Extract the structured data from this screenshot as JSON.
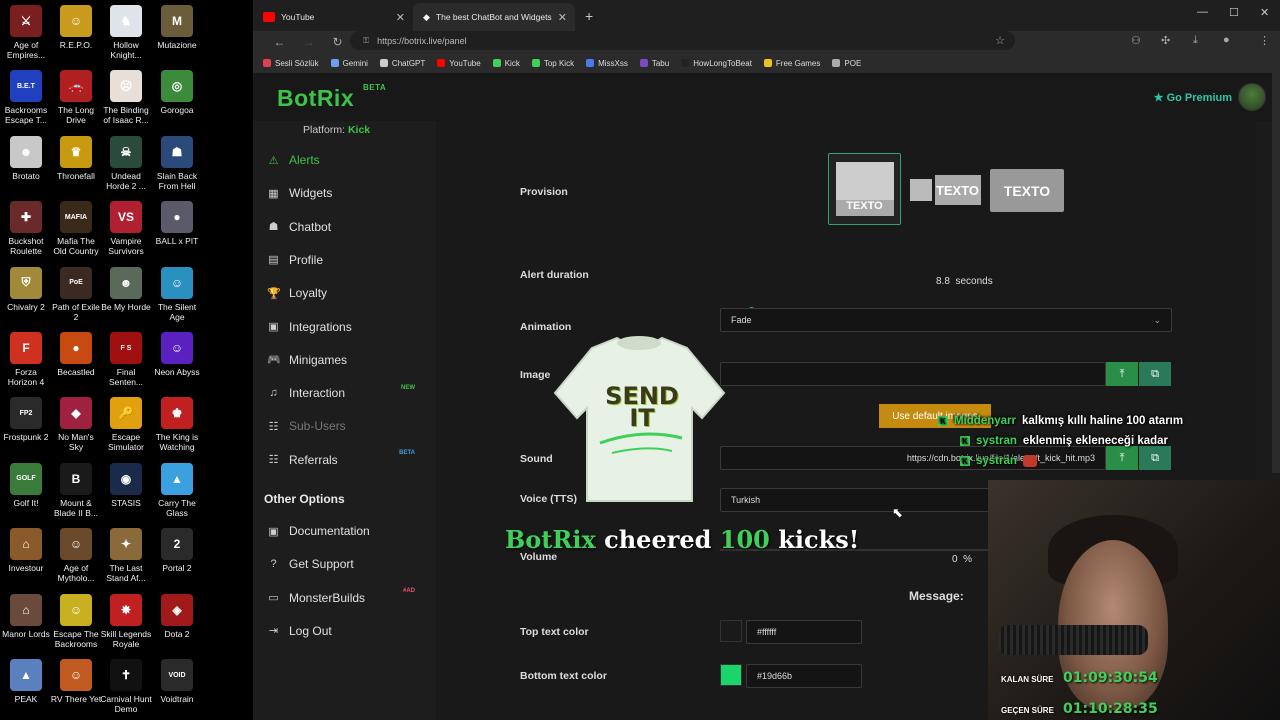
{
  "desktop": {
    "icons": [
      {
        "label": "Age of Empires...",
        "color": "#7a1f1f",
        "glyph": "⚔"
      },
      {
        "label": "R.E.P.O.",
        "color": "#c89b1e",
        "glyph": "☺"
      },
      {
        "label": "Hollow Knight...",
        "color": "#dfe3ea",
        "glyph": "♞"
      },
      {
        "label": "Mutazione",
        "color": "#6b5c3a",
        "glyph": "M"
      },
      {
        "label": "Backrooms Escape T...",
        "color": "#2040c0",
        "glyph": "B.E.T"
      },
      {
        "label": "The Long Drive",
        "color": "#b02020",
        "glyph": "🚗"
      },
      {
        "label": "The Binding of Isaac R...",
        "color": "#e8e0d8",
        "glyph": "☹"
      },
      {
        "label": "Gorogoa",
        "color": "#3c8a3c",
        "glyph": "◎"
      },
      {
        "label": "Brotato",
        "color": "#c8c8c8",
        "glyph": "☻"
      },
      {
        "label": "Thronefall",
        "color": "#c89a10",
        "glyph": "♛"
      },
      {
        "label": "Undead Horde 2 ...",
        "color": "#2a4a3a",
        "glyph": "☠"
      },
      {
        "label": "Slain Back From Hell",
        "color": "#2a4a7a",
        "glyph": "☗"
      },
      {
        "label": "Buckshot Roulette",
        "color": "#6a2a2a",
        "glyph": "✚"
      },
      {
        "label": "Mafia The Old Country",
        "color": "#3a2a1a",
        "glyph": "MAFIA"
      },
      {
        "label": "Vampire Survivors",
        "color": "#b02030",
        "glyph": "VS"
      },
      {
        "label": "BALL x PIT",
        "color": "#5a5a6a",
        "glyph": "●"
      },
      {
        "label": "Chivalry 2",
        "color": "#a08a3a",
        "glyph": "⛨"
      },
      {
        "label": "Path of Exile 2",
        "color": "#3a2a22",
        "glyph": "PoE"
      },
      {
        "label": "Be My Horde",
        "color": "#5a6a5a",
        "glyph": "☻"
      },
      {
        "label": "The Silent Age",
        "color": "#2a90c0",
        "glyph": "☺"
      },
      {
        "label": "Forza Horizon 4",
        "color": "#d03020",
        "glyph": "F"
      },
      {
        "label": "Becastled",
        "color": "#c84a10",
        "glyph": "●"
      },
      {
        "label": "Final Senten...",
        "color": "#a01010",
        "glyph": "F S"
      },
      {
        "label": "Neon Abyss",
        "color": "#5a20c0",
        "glyph": "☺"
      },
      {
        "label": "Frostpunk 2",
        "color": "#2a2a2a",
        "glyph": "FP2"
      },
      {
        "label": "No Man's Sky",
        "color": "#a02040",
        "glyph": "◆"
      },
      {
        "label": "Escape Simulator",
        "color": "#e0a010",
        "glyph": "🔑"
      },
      {
        "label": "The King is Watching",
        "color": "#c02020",
        "glyph": "♚"
      },
      {
        "label": "Golf It!",
        "color": "#3a7a3a",
        "glyph": "GOLF"
      },
      {
        "label": "Mount & Blade II B...",
        "color": "#1a1a1a",
        "glyph": "B"
      },
      {
        "label": "STASIS",
        "color": "#1a2a4a",
        "glyph": "◉"
      },
      {
        "label": "Carry The Glass",
        "color": "#3aa0e0",
        "glyph": "▲"
      },
      {
        "label": "Investour",
        "color": "#8a5a2a",
        "glyph": "⌂"
      },
      {
        "label": "Age of Mytholo...",
        "color": "#6a4a2a",
        "glyph": "☺"
      },
      {
        "label": "The Last Stand Af...",
        "color": "#8a6a3a",
        "glyph": "✦"
      },
      {
        "label": "Portal 2",
        "color": "#2a2a2a",
        "glyph": "2"
      },
      {
        "label": "Manor Lords",
        "color": "#6a4a3a",
        "glyph": "⌂"
      },
      {
        "label": "Escape The Backrooms",
        "color": "#c8b020",
        "glyph": "☺"
      },
      {
        "label": "Skill Legends Royale",
        "color": "#c02020",
        "glyph": "✸"
      },
      {
        "label": "Dota 2",
        "color": "#a01a1a",
        "glyph": "◈"
      },
      {
        "label": "PEAK",
        "color": "#5a80c0",
        "glyph": "▲"
      },
      {
        "label": "RV There Yet",
        "color": "#c05a20",
        "glyph": "☺"
      },
      {
        "label": "Carnival Hunt Demo",
        "color": "#111111",
        "glyph": "✝"
      },
      {
        "label": "Voidtrain",
        "color": "#2a2a2a",
        "glyph": "VOID"
      }
    ]
  },
  "browser": {
    "tabs": [
      {
        "label": "YouTube",
        "color": "#ff0000"
      },
      {
        "label": "The best ChatBot and Widgets fo",
        "color": "#ffffff"
      }
    ],
    "url": "https://botrix.live/panel",
    "bookmarks": [
      {
        "label": "Sesli Sözlük",
        "color": "#e04050"
      },
      {
        "label": "Gemini",
        "color": "#6aa0f0"
      },
      {
        "label": "ChatGPT",
        "color": "#cccccc"
      },
      {
        "label": "YouTube",
        "color": "#ff0000"
      },
      {
        "label": "Kick",
        "color": "#3fd05a"
      },
      {
        "label": "Top Kick",
        "color": "#3fd05a"
      },
      {
        "label": "MissXss",
        "color": "#4a7af0"
      },
      {
        "label": "Tabu",
        "color": "#7a4ac0"
      },
      {
        "label": "HowLongToBeat",
        "color": "#222222"
      },
      {
        "label": "Free Games",
        "color": "#f0c020"
      },
      {
        "label": "POE",
        "color": "#aaaaaa"
      }
    ]
  },
  "header": {
    "logo": "BotRix",
    "logo_badge": "BETA",
    "premium": "Go Premium"
  },
  "sidebar": {
    "platform_label": "Platform:",
    "platform_value": "Kick",
    "items": [
      {
        "label": "Alerts",
        "icon": "⚠",
        "icon_name": "alert-icon",
        "state": "active",
        "tag": ""
      },
      {
        "label": "Widgets",
        "icon": "▦",
        "icon_name": "widgets-icon",
        "state": "",
        "tag": ""
      },
      {
        "label": "Chatbot",
        "icon": "☗",
        "icon_name": "robot-icon",
        "state": "",
        "tag": ""
      },
      {
        "label": "Profile",
        "icon": "▤",
        "icon_name": "profile-icon",
        "state": "",
        "tag": ""
      },
      {
        "label": "Loyalty",
        "icon": "🏆",
        "icon_name": "trophy-icon",
        "state": "",
        "tag": ""
      },
      {
        "label": "Integrations",
        "icon": "▣",
        "icon_name": "integrations-icon",
        "state": "",
        "tag": ""
      },
      {
        "label": "Minigames",
        "icon": "🎮",
        "icon_name": "gamepad-icon",
        "state": "",
        "tag": ""
      },
      {
        "label": "Interaction",
        "icon": "♫",
        "icon_name": "music-icon",
        "state": "",
        "tag": "NEW"
      },
      {
        "label": "Sub-Users",
        "icon": "☷",
        "icon_name": "users-icon",
        "state": "disabled",
        "tag": ""
      },
      {
        "label": "Referrals",
        "icon": "☷",
        "icon_name": "referrals-icon",
        "state": "",
        "tag": "BETA"
      }
    ],
    "other_title": "Other Options",
    "other_items": [
      {
        "label": "Documentation",
        "icon": "▣",
        "icon_name": "documentation-icon",
        "tag": ""
      },
      {
        "label": "Get Support",
        "icon": "?",
        "icon_name": "help-icon",
        "tag": ""
      },
      {
        "label": "MonsterBuilds",
        "icon": "▭",
        "icon_name": "laptop-icon",
        "tag": "#AD"
      },
      {
        "label": "Log Out",
        "icon": "⇥",
        "icon_name": "logout-icon",
        "tag": ""
      }
    ]
  },
  "form": {
    "provision_label": "Provision",
    "provision_options": [
      "TEXTO",
      "TEXTO",
      "TEXTO"
    ],
    "alert_duration_label": "Alert duration",
    "alert_duration_value": "8.8",
    "alert_duration_unit": "seconds",
    "alert_duration_fraction": 0.068,
    "animation_label": "Animation",
    "animation_value": "Fade",
    "image_label": "Image",
    "image_value": "",
    "use_default": "Use default images",
    "sound_label": "Sound",
    "sound_value": "https://cdn.botrix.live/file/1/alerts/t_kick_hit.mp3",
    "voice_label": "Voice (TTS)",
    "voice_value": "Turkish",
    "volume_label": "Volume",
    "volume_value": "0",
    "volume_unit": "%",
    "message_label": "Message:",
    "top_text_label": "Top text color",
    "top_text_value": "#ffffff",
    "top_text_color": "#1a1a1a",
    "bottom_text_label": "Bottom text color",
    "bottom_text_value": "#19d66b",
    "bottom_text_color": "#19d66b"
  },
  "overlay": {
    "shirt_line1": "SEND",
    "shirt_line2": "IT",
    "cheer_user": "BotRix",
    "cheer_mid": "cheered",
    "cheer_amount": "100",
    "cheer_end": "kicks!",
    "chat": [
      {
        "user": "Middenyarr",
        "message": "kalkmış kıllı haline 100 atarım"
      },
      {
        "user": "systran",
        "message": "eklenmiş ekleneceği kadar"
      },
      {
        "user": "systran",
        "message": ""
      }
    ],
    "timer_remaining_label": "KALAN SÜRE",
    "timer_remaining_value": "01:09:30:54",
    "timer_elapsed_label": "GEÇEN SÜRE",
    "timer_elapsed_value": "01:10:28:35"
  }
}
